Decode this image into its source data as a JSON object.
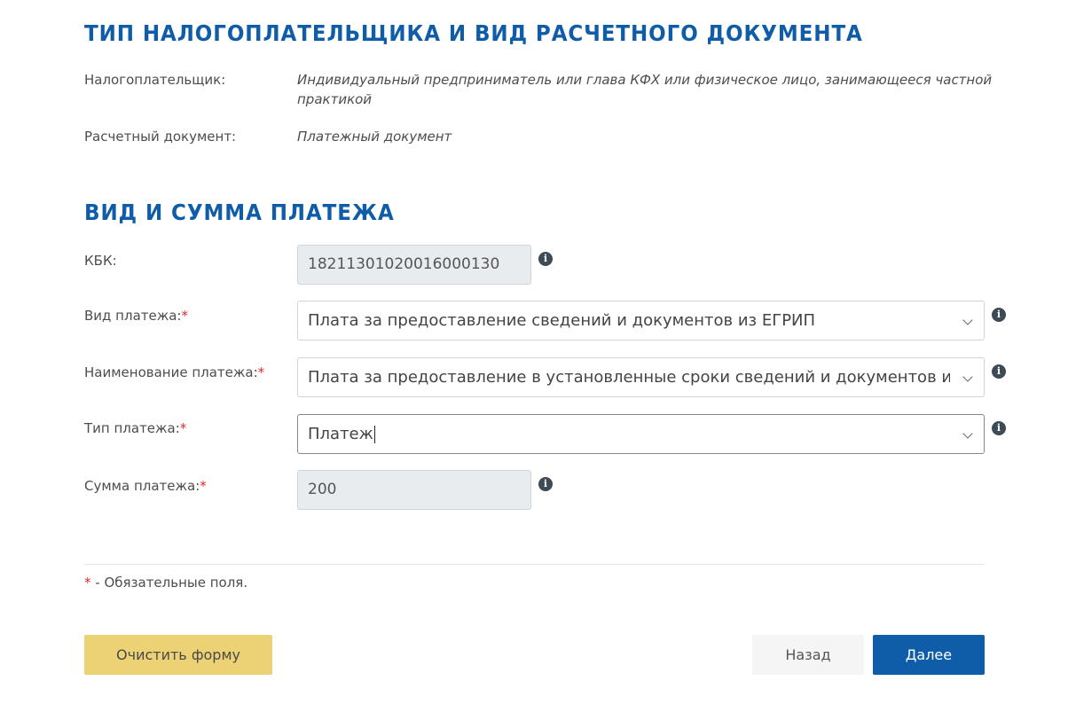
{
  "section1": {
    "title": "ТИП НАЛОГОПЛАТЕЛЬЩИКА И ВИД РАСЧЕТНОГО ДОКУМЕНТА",
    "taxpayer_label": "Налогоплательщик:",
    "taxpayer_value": "Индивидуальный предприниматель или глава КФХ или физическое лицо, занимающееся частной практикой",
    "document_label": "Расчетный документ:",
    "document_value": "Платежный документ"
  },
  "section2": {
    "title": "ВИД И СУММА ПЛАТЕЖА",
    "kbk": {
      "label": "КБК:",
      "value": "18211301020016000130"
    },
    "payment_kind": {
      "label": "Вид платежа:",
      "required": "*",
      "value": "Плата за предоставление сведений и документов из ЕГРИП"
    },
    "payment_name": {
      "label": "Наименование платежа:",
      "required": "*",
      "value": "Плата за предоставление в установленные сроки сведений и документов из ЕГРИП"
    },
    "payment_type": {
      "label": "Тип платежа:",
      "required": "*",
      "value": "Платеж"
    },
    "amount": {
      "label": "Сумма платежа:",
      "required": "*",
      "value": "200"
    }
  },
  "required_note": {
    "star": "*",
    "text": " - Обязательные поля."
  },
  "buttons": {
    "clear": "Очистить форму",
    "back": "Назад",
    "next": "Далее"
  },
  "icons": {
    "info": "info-icon",
    "dropdown": "chevron-down-icon"
  },
  "colors": {
    "accent": "#0f5da8",
    "required": "#e02a2a",
    "clear_button": "#ecd175"
  }
}
